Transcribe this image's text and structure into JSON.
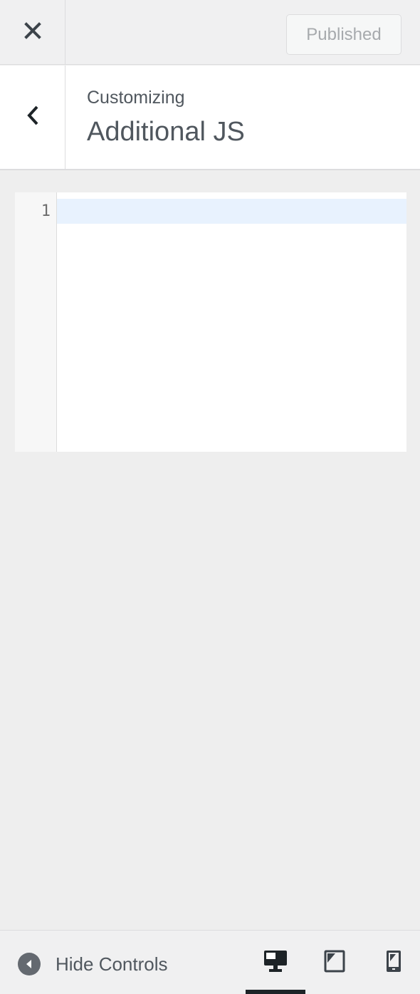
{
  "header": {
    "close_icon": "close-icon",
    "publish_label": "Published"
  },
  "section": {
    "back_icon": "chevron-left-icon",
    "subtitle": "Customizing",
    "title": "Additional JS"
  },
  "editor": {
    "line_numbers": [
      "1"
    ],
    "content": ""
  },
  "footer": {
    "hide_controls_label": "Hide Controls",
    "devices": [
      {
        "name": "desktop",
        "icon": "desktop-icon",
        "active": true
      },
      {
        "name": "tablet",
        "icon": "tablet-icon",
        "active": false
      },
      {
        "name": "mobile",
        "icon": "mobile-icon",
        "active": false
      }
    ]
  },
  "colors": {
    "panel_bg": "#eeeeee",
    "active_line": "#e8f2fe",
    "text_muted": "#50575e"
  }
}
